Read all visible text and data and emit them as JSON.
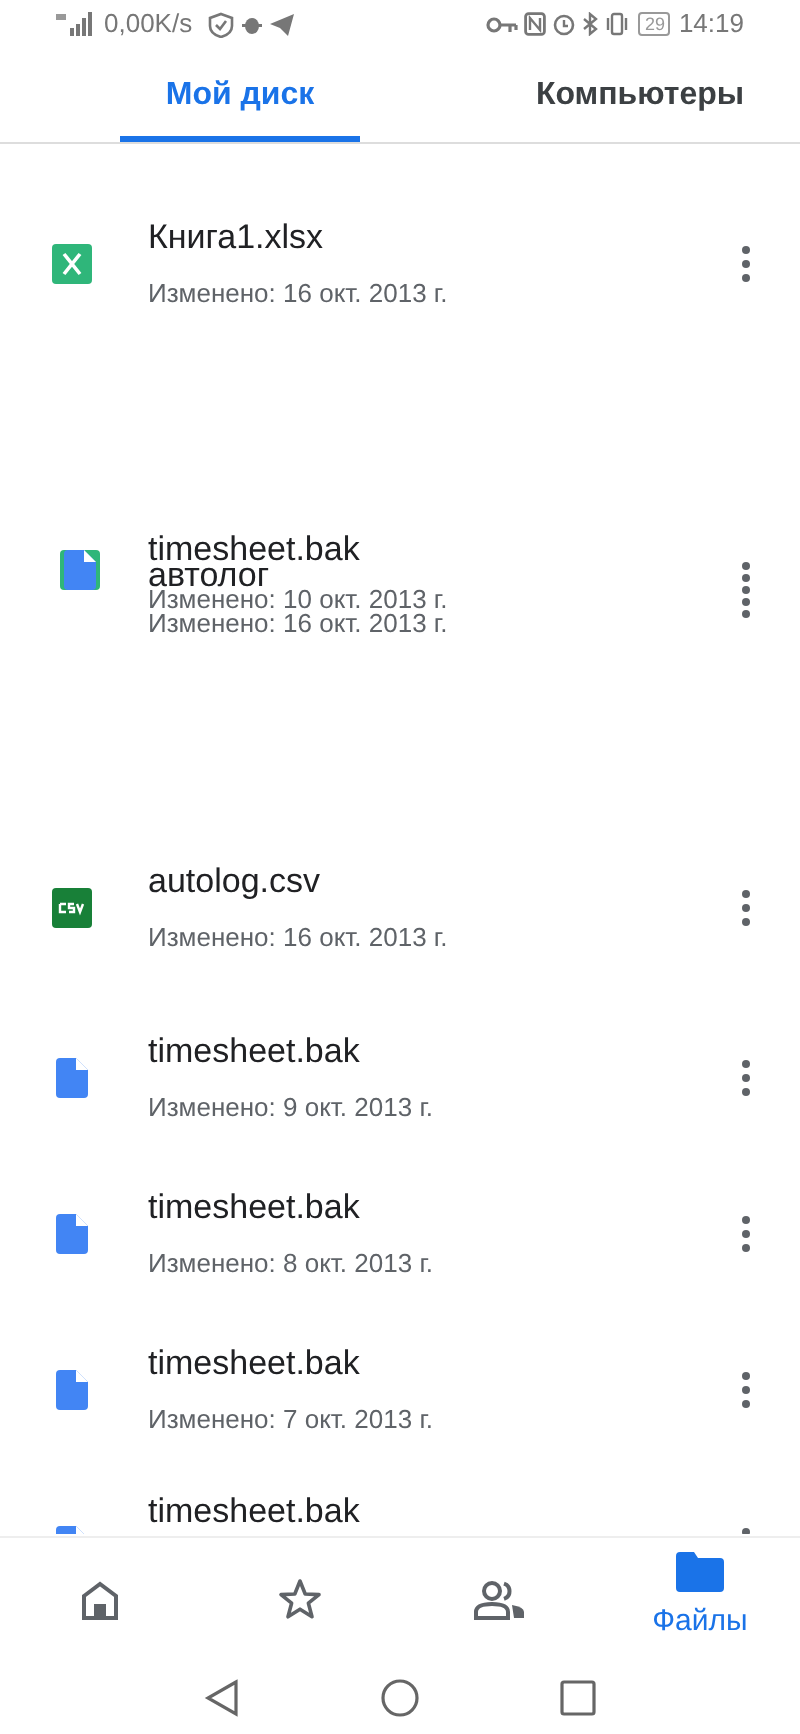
{
  "status_bar": {
    "speed": "0,00K/s",
    "battery": "29",
    "time": "14:19"
  },
  "tabs": [
    {
      "label": "Мой диск",
      "selected": true
    },
    {
      "label": "Компьютеры",
      "selected": false
    }
  ],
  "files": [
    {
      "kind": "sheet",
      "name": "Книга1.xlsx",
      "modified": "Изменено: 16 окт. 2013 г."
    },
    {
      "kind": "overlap",
      "layers": [
        {
          "kind": "doc",
          "name": "timesheet.bak",
          "modified": "Изменено: 10 окт. 2013 г."
        },
        {
          "kind": "sheet",
          "name": "автолог",
          "modified": "Изменено: 16 окт. 2013 г."
        }
      ]
    },
    {
      "kind": "csv",
      "name": "autolog.csv",
      "modified": "Изменено: 16 окт. 2013 г."
    },
    {
      "kind": "doc",
      "name": "timesheet.bak",
      "modified": "Изменено: 9 окт. 2013 г."
    },
    {
      "kind": "doc",
      "name": "timesheet.bak",
      "modified": "Изменено: 8 окт. 2013 г."
    },
    {
      "kind": "doc",
      "name": "timesheet.bak",
      "modified": "Изменено: 7 окт. 2013 г."
    },
    {
      "kind": "doc",
      "name": "timesheet.bak"
    }
  ],
  "bottom_nav": [
    {
      "kind": "home",
      "selected": false
    },
    {
      "kind": "star",
      "selected": false
    },
    {
      "kind": "people",
      "selected": false
    },
    {
      "kind": "folder",
      "label": "Файлы",
      "selected": true
    }
  ]
}
